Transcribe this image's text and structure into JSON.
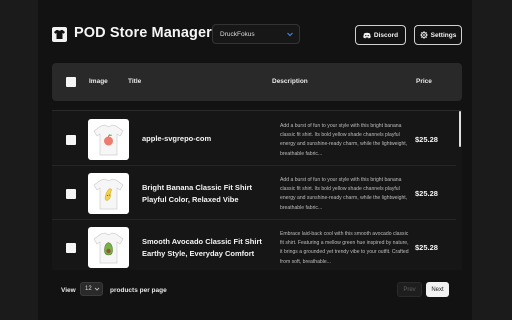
{
  "header": {
    "logo_icon": "tshirt-icon",
    "title": "POD Store Manager",
    "store_select": {
      "value": "DruckFokus",
      "icon": "chevron-down-icon"
    },
    "discord_button": {
      "label": "Discord",
      "icon": "discord-icon"
    },
    "settings_button": {
      "label": "Settings",
      "icon": "gear-icon"
    }
  },
  "table": {
    "columns": {
      "image": "Image",
      "title": "Title",
      "description": "Description",
      "price": "Price"
    },
    "rows": [
      {
        "title": "apple-svgrepo-com",
        "description": "Add a burst of fun to your style with this bright banana classic fit shirt. Its bold yellow shade channels playful energy and sunshine-ready charm, while the lightweight, breathable fabric...",
        "price": "$25.28",
        "image_icon": "tshirt-apple-print-icon"
      },
      {
        "title": "Bright Banana Classic Fit Shirt Playful Color, Relaxed Vibe",
        "description": "Add a burst of fun to your style with this bright banana classic fit shirt. Its bold yellow shade channels playful energy and sunshine-ready charm, while the lightweight, breathable fabric...",
        "price": "$25.28",
        "image_icon": "tshirt-banana-print-icon"
      },
      {
        "title": "Smooth Avocado Classic Fit Shirt Earthy Style, Everyday Comfort",
        "description": "Embrace laid-back cool with this smooth avocado classic fit shirt. Featuring a mellow green hue inspired by nature, it brings a grounded yet trendy vibe to your outfit. Crafted from soft, breathable...",
        "price": "$25.28",
        "image_icon": "tshirt-avocado-print-icon"
      }
    ]
  },
  "footer": {
    "view_label": "View",
    "per_page_value": "12",
    "per_page_label": "products per page",
    "prev_label": "Prev",
    "next_label": "Next"
  },
  "colors": {
    "background": "#1b1b1b",
    "panel": "#121212",
    "table_header": "#292929",
    "text": "#f2f2f2"
  }
}
